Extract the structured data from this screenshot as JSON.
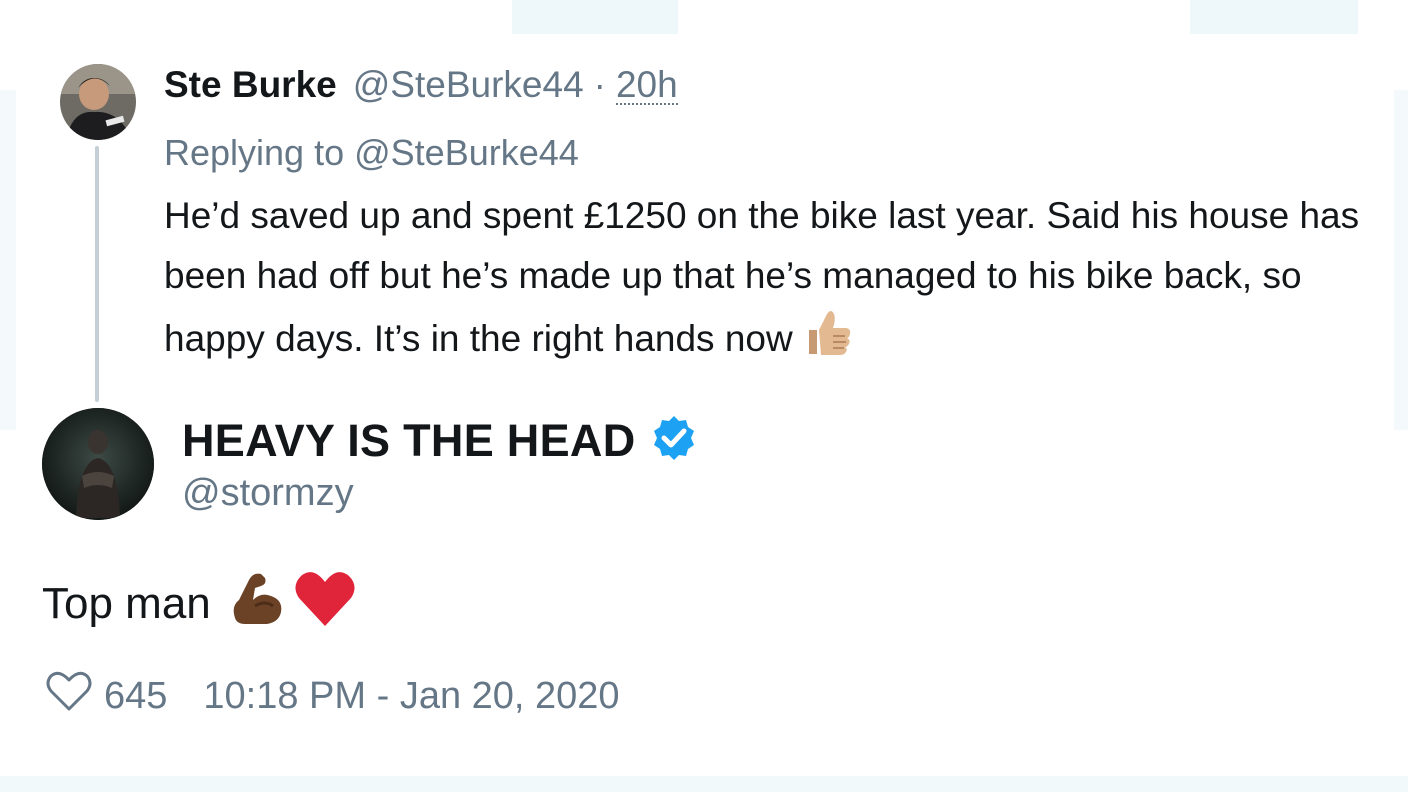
{
  "reply_tweet": {
    "name": "Ste Burke",
    "handle": "@SteBurke44",
    "separator": "·",
    "time": "20h",
    "replying_to": "Replying to @SteBurke44",
    "text": "He’d saved up and spent £1250 on the bike last year. Said his house has been had off but he’s made up that he’s managed to his bike back, so happy days. It’s in the right hands now",
    "trailing_emoji": "thumbs-up-icon"
  },
  "main_tweet": {
    "name": "HEAVY IS THE HEAD",
    "verified": true,
    "handle": "@stormzy",
    "text": "Top man",
    "emojis": [
      "flexed-biceps-icon",
      "red-heart-icon"
    ],
    "likes": "645",
    "timestamp": "10:18 PM - Jan 20, 2020"
  },
  "colors": {
    "text_primary": "#14171a",
    "text_secondary": "#657786",
    "verified_blue": "#1da1f2",
    "heart_red": "#e0245e",
    "thread_line": "#c4cfd6"
  }
}
